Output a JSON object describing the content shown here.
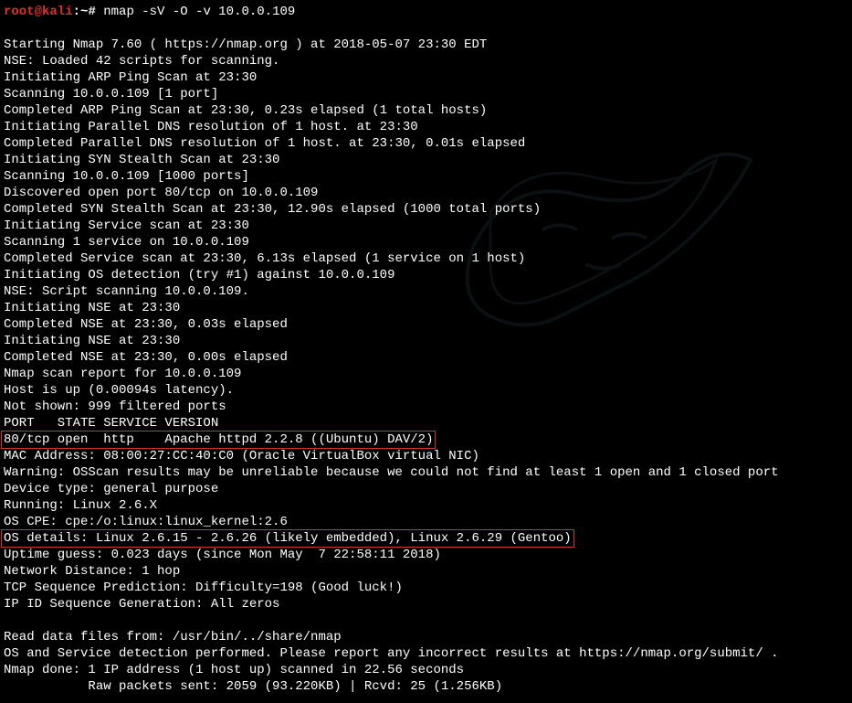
{
  "prompt": {
    "user": "root@kali",
    "colon": ":",
    "path": "~",
    "hash": "# ",
    "command": "nmap -sV -O -v 10.0.0.109"
  },
  "lines": [
    "",
    "Starting Nmap 7.60 ( https://nmap.org ) at 2018-05-07 23:30 EDT",
    "NSE: Loaded 42 scripts for scanning.",
    "Initiating ARP Ping Scan at 23:30",
    "Scanning 10.0.0.109 [1 port]",
    "Completed ARP Ping Scan at 23:30, 0.23s elapsed (1 total hosts)",
    "Initiating Parallel DNS resolution of 1 host. at 23:30",
    "Completed Parallel DNS resolution of 1 host. at 23:30, 0.01s elapsed",
    "Initiating SYN Stealth Scan at 23:30",
    "Scanning 10.0.0.109 [1000 ports]",
    "Discovered open port 80/tcp on 10.0.0.109",
    "Completed SYN Stealth Scan at 23:30, 12.90s elapsed (1000 total ports)",
    "Initiating Service scan at 23:30",
    "Scanning 1 service on 10.0.0.109",
    "Completed Service scan at 23:30, 6.13s elapsed (1 service on 1 host)",
    "Initiating OS detection (try #1) against 10.0.0.109",
    "NSE: Script scanning 10.0.0.109.",
    "Initiating NSE at 23:30",
    "Completed NSE at 23:30, 0.03s elapsed",
    "Initiating NSE at 23:30",
    "Completed NSE at 23:30, 0.00s elapsed",
    "Nmap scan report for 10.0.0.109",
    "Host is up (0.00094s latency).",
    "Not shown: 999 filtered ports",
    "PORT   STATE SERVICE VERSION"
  ],
  "highlight1": "80/tcp open  http    Apache httpd 2.2.8 ((Ubuntu) DAV/2)",
  "lines2": [
    "MAC Address: 08:00:27:CC:40:C0 (Oracle VirtualBox virtual NIC)",
    "Warning: OSScan results may be unreliable because we could not find at least 1 open and 1 closed port",
    "Device type: general purpose",
    "Running: Linux 2.6.X",
    "OS CPE: cpe:/o:linux:linux_kernel:2.6"
  ],
  "highlight2": "OS details: Linux 2.6.15 - 2.6.26 (likely embedded), Linux 2.6.29 (Gentoo)",
  "lines3": [
    "Uptime guess: 0.023 days (since Mon May  7 22:58:11 2018)",
    "Network Distance: 1 hop",
    "TCP Sequence Prediction: Difficulty=198 (Good luck!)",
    "IP ID Sequence Generation: All zeros",
    "",
    "Read data files from: /usr/bin/../share/nmap",
    "OS and Service detection performed. Please report any incorrect results at https://nmap.org/submit/ .",
    "Nmap done: 1 IP address (1 host up) scanned in 22.56 seconds",
    "           Raw packets sent: 2059 (93.220KB) | Rcvd: 25 (1.256KB)"
  ]
}
